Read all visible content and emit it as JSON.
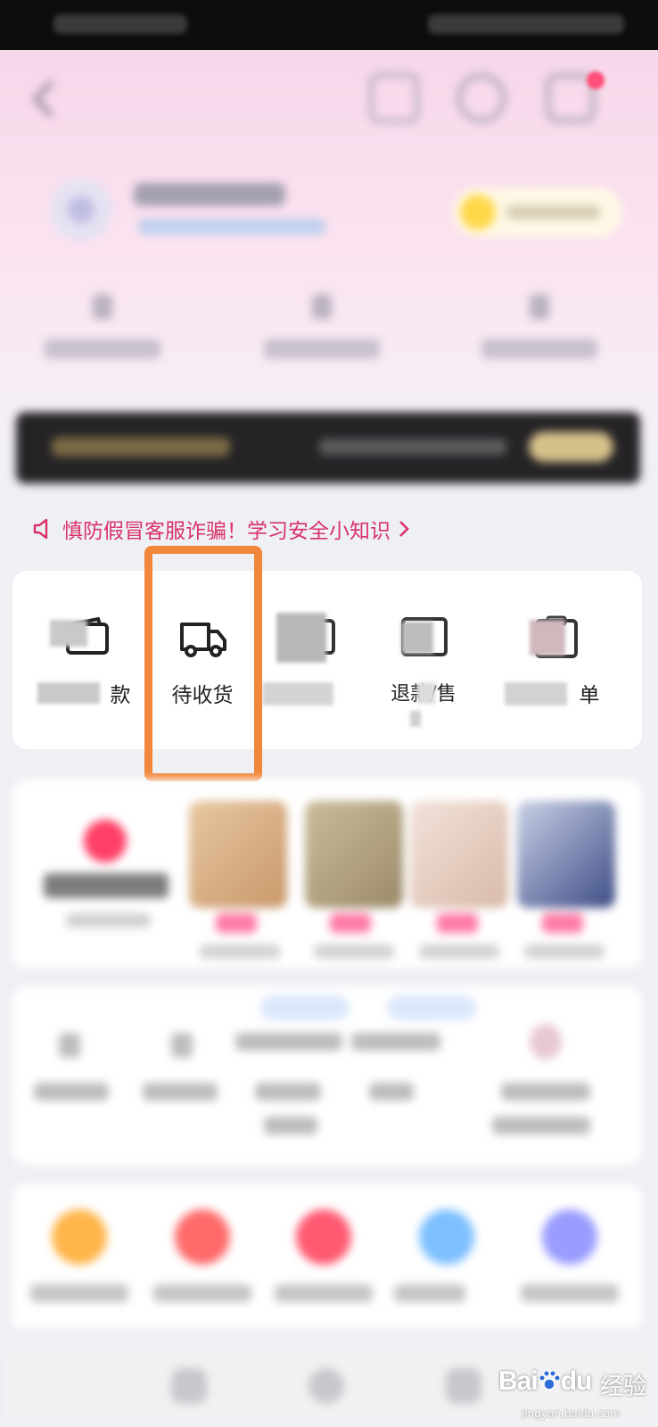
{
  "notice": {
    "text": "慎防假冒客服诈骗！学习安全小知识"
  },
  "orders": {
    "items": [
      {
        "label": "款",
        "icon": "wallet-icon"
      },
      {
        "label": "待收货",
        "icon": "delivery-truck-icon"
      },
      {
        "label": "",
        "icon": "review-icon"
      },
      {
        "label": "退款/售",
        "icon": "refund-icon"
      },
      {
        "label": "单",
        "icon": "all-orders-icon"
      }
    ]
  },
  "watermark": {
    "brand_a": "Bai",
    "brand_b": "du",
    "brand_cn": "经验",
    "url": "jingyan.baidu.com"
  },
  "colors": {
    "highlight": "#f0873a",
    "notice": "#d8326a",
    "header_pink": "#f7d7ea"
  }
}
